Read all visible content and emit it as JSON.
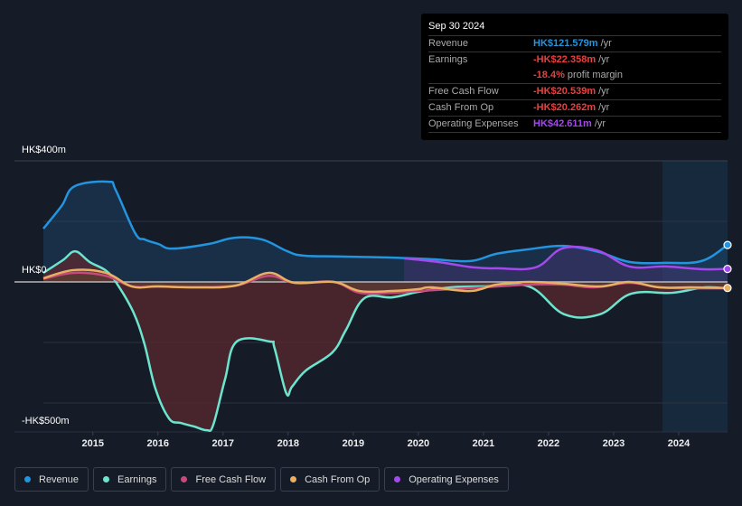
{
  "tooltip": {
    "date": "Sep 30 2024",
    "rows": [
      {
        "label": "Revenue",
        "value": "HK$121.579m",
        "unit": "/yr",
        "color": "#2394df"
      },
      {
        "label": "Earnings",
        "value": "-HK$22.358m",
        "unit": "/yr",
        "color": "#e64141"
      },
      {
        "label": "",
        "value": "-18.4%",
        "unit": "profit margin",
        "color": "#e64141"
      },
      {
        "label": "Free Cash Flow",
        "value": "-HK$20.539m",
        "unit": "/yr",
        "color": "#e64141"
      },
      {
        "label": "Cash From Op",
        "value": "-HK$20.262m",
        "unit": "/yr",
        "color": "#e64141"
      },
      {
        "label": "Operating Expenses",
        "value": "HK$42.611m",
        "unit": "/yr",
        "color": "#a349ed"
      }
    ]
  },
  "legend": [
    {
      "label": "Revenue",
      "color": "#2394df"
    },
    {
      "label": "Earnings",
      "color": "#6ce5cf"
    },
    {
      "label": "Free Cash Flow",
      "color": "#c84a7d"
    },
    {
      "label": "Cash From Op",
      "color": "#e8b060"
    },
    {
      "label": "Operating Expenses",
      "color": "#a349ed"
    }
  ],
  "chart_data": {
    "type": "line",
    "title": "",
    "xlabel": "",
    "ylabel": "",
    "currency": "HK$",
    "y_tick_labels": [
      "HK$400m",
      "HK$0",
      "-HK$500m"
    ],
    "ylim": [
      -500,
      400
    ],
    "xlim": [
      2014.24,
      2024.75
    ],
    "x_ticks": [
      2015,
      2016,
      2017,
      2018,
      2019,
      2020,
      2021,
      2022,
      2023,
      2024
    ],
    "highlight_from": 2024.0,
    "grid": true,
    "legend_position": "bottom-left",
    "series": [
      {
        "name": "Revenue",
        "color": "#2394df",
        "points": [
          [
            2014.24,
            176
          ],
          [
            2014.52,
            251
          ],
          [
            2014.72,
            316
          ],
          [
            2015.24,
            331
          ],
          [
            2015.35,
            304
          ],
          [
            2015.65,
            161
          ],
          [
            2015.8,
            140
          ],
          [
            2016.01,
            125
          ],
          [
            2016.22,
            110
          ],
          [
            2016.77,
            125
          ],
          [
            2017.18,
            146
          ],
          [
            2017.6,
            140
          ],
          [
            2017.98,
            102
          ],
          [
            2018.23,
            87
          ],
          [
            2018.8,
            84
          ],
          [
            2019.5,
            81
          ],
          [
            2020.2,
            75
          ],
          [
            2020.8,
            69
          ],
          [
            2021.2,
            93
          ],
          [
            2021.7,
            108
          ],
          [
            2022.23,
            119
          ],
          [
            2022.77,
            99
          ],
          [
            2023.24,
            66
          ],
          [
            2023.8,
            63
          ],
          [
            2024.35,
            69
          ],
          [
            2024.75,
            122
          ]
        ]
      },
      {
        "name": "Earnings",
        "color": "#6ce5cf",
        "points": [
          [
            2014.24,
            30
          ],
          [
            2014.54,
            72
          ],
          [
            2014.73,
            101
          ],
          [
            2014.95,
            66
          ],
          [
            2015.21,
            36
          ],
          [
            2015.38,
            -9
          ],
          [
            2015.62,
            -99
          ],
          [
            2015.79,
            -203
          ],
          [
            2015.96,
            -352
          ],
          [
            2016.17,
            -451
          ],
          [
            2016.35,
            -466
          ],
          [
            2016.56,
            -478
          ],
          [
            2016.75,
            -490
          ],
          [
            2016.85,
            -472
          ],
          [
            2017.03,
            -322
          ],
          [
            2017.21,
            -197
          ],
          [
            2017.72,
            -197
          ],
          [
            2017.79,
            -218
          ],
          [
            2017.97,
            -367
          ],
          [
            2018.06,
            -346
          ],
          [
            2018.27,
            -293
          ],
          [
            2018.68,
            -233
          ],
          [
            2018.89,
            -158
          ],
          [
            2019.17,
            -54
          ],
          [
            2019.6,
            -51
          ],
          [
            2020.0,
            -33
          ],
          [
            2020.5,
            -18
          ],
          [
            2021.0,
            -15
          ],
          [
            2021.7,
            -15
          ],
          [
            2022.24,
            -107
          ],
          [
            2022.79,
            -107
          ],
          [
            2023.27,
            -39
          ],
          [
            2023.9,
            -36
          ],
          [
            2024.4,
            -18
          ],
          [
            2024.75,
            -22
          ]
        ]
      },
      {
        "name": "Free Cash Flow",
        "color": "#c84a7d",
        "points": [
          [
            2014.24,
            10
          ],
          [
            2014.7,
            30
          ],
          [
            2015.2,
            20
          ],
          [
            2015.6,
            -15
          ],
          [
            2016.0,
            -15
          ],
          [
            2016.6,
            -18
          ],
          [
            2017.2,
            -12
          ],
          [
            2017.7,
            20
          ],
          [
            2018.1,
            -3
          ],
          [
            2018.7,
            0
          ],
          [
            2019.1,
            -36
          ],
          [
            2019.6,
            -36
          ],
          [
            2020.0,
            -30
          ],
          [
            2020.5,
            -24
          ],
          [
            2021.0,
            -18
          ],
          [
            2021.7,
            -9
          ],
          [
            2022.23,
            -9
          ],
          [
            2022.7,
            -18
          ],
          [
            2023.24,
            -3
          ],
          [
            2023.7,
            -18
          ],
          [
            2024.2,
            -21
          ],
          [
            2024.75,
            -21
          ]
        ]
      },
      {
        "name": "Cash From Op",
        "color": "#e8b060",
        "points": [
          [
            2014.24,
            12
          ],
          [
            2014.7,
            39
          ],
          [
            2015.2,
            30
          ],
          [
            2015.6,
            -15
          ],
          [
            2016.0,
            -15
          ],
          [
            2016.6,
            -18
          ],
          [
            2017.2,
            -12
          ],
          [
            2017.7,
            30
          ],
          [
            2018.1,
            -3
          ],
          [
            2018.7,
            0
          ],
          [
            2019.1,
            -30
          ],
          [
            2019.6,
            -30
          ],
          [
            2020.0,
            -24
          ],
          [
            2020.2,
            -18
          ],
          [
            2020.8,
            -30
          ],
          [
            2021.2,
            -9
          ],
          [
            2021.7,
            0
          ],
          [
            2022.23,
            -6
          ],
          [
            2022.8,
            -15
          ],
          [
            2023.24,
            0
          ],
          [
            2023.7,
            -18
          ],
          [
            2024.2,
            -18
          ],
          [
            2024.75,
            -20
          ]
        ]
      },
      {
        "name": "Operating Expenses",
        "color": "#a349ed",
        "points": [
          [
            2019.78,
            78
          ],
          [
            2020.3,
            66
          ],
          [
            2020.85,
            48
          ],
          [
            2021.2,
            45
          ],
          [
            2021.8,
            48
          ],
          [
            2022.22,
            111
          ],
          [
            2022.75,
            104
          ],
          [
            2023.24,
            51
          ],
          [
            2023.8,
            51
          ],
          [
            2024.35,
            42
          ],
          [
            2024.75,
            43
          ]
        ]
      }
    ]
  }
}
